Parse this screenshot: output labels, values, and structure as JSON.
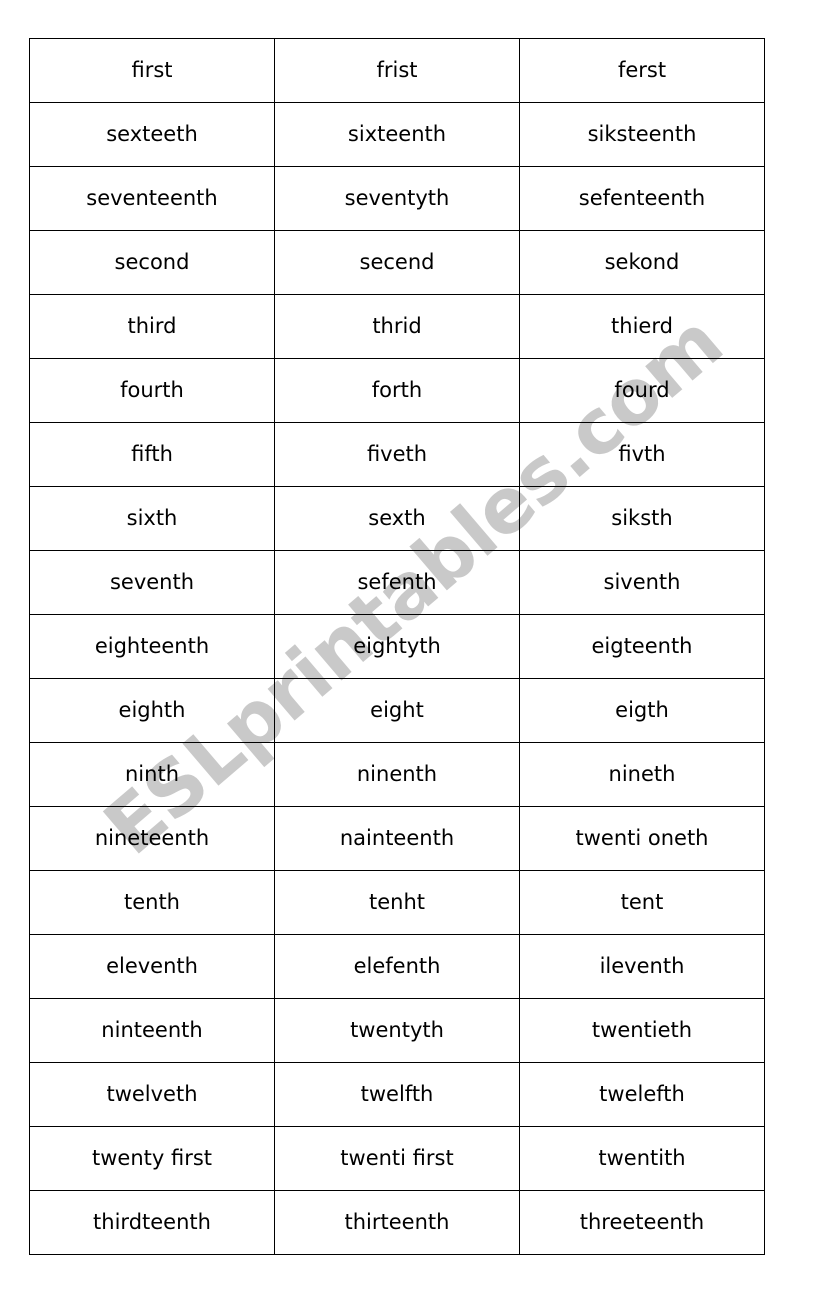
{
  "page": {
    "background_color": "#ffffff",
    "text_color": "#000000",
    "border_color": "#000000"
  },
  "watermark": {
    "text": "ESLprintables.com",
    "color": "#c9c9c9",
    "rotation_deg": -40.5
  },
  "table": {
    "columns": 3,
    "rows": 18,
    "cells": [
      [
        "first",
        "frist",
        "ferst"
      ],
      [
        "sexteeth",
        "sixteenth",
        "siksteenth"
      ],
      [
        "seventeenth",
        "seventyth",
        "sefenteenth"
      ],
      [
        "second",
        "secend",
        "sekond"
      ],
      [
        "third",
        "thrid",
        "thierd"
      ],
      [
        "fourth",
        "forth",
        "fourd"
      ],
      [
        "fifth",
        "fiveth",
        "fivth"
      ],
      [
        "sixth",
        "sexth",
        "siksth"
      ],
      [
        "seventh",
        "sefenth",
        "siventh"
      ],
      [
        "eighteenth",
        "eightyth",
        "eigteenth"
      ],
      [
        "eighth",
        "eight",
        "eigth"
      ],
      [
        "ninth",
        "ninenth",
        "nineth"
      ],
      [
        "nineteenth",
        "nainteenth",
        "twenti oneth"
      ],
      [
        "tenth",
        "tenht",
        "tent"
      ],
      [
        "eleventh",
        "elefenth",
        "ileventh"
      ],
      [
        "ninteenth",
        "twentyth",
        "twentieth"
      ],
      [
        "twelveth",
        "twelfth",
        "twelefth"
      ],
      [
        "twenty first",
        "twenti first",
        "twentith"
      ],
      [
        "thirdteenth",
        "thirteenth",
        "threeteenth"
      ]
    ]
  }
}
